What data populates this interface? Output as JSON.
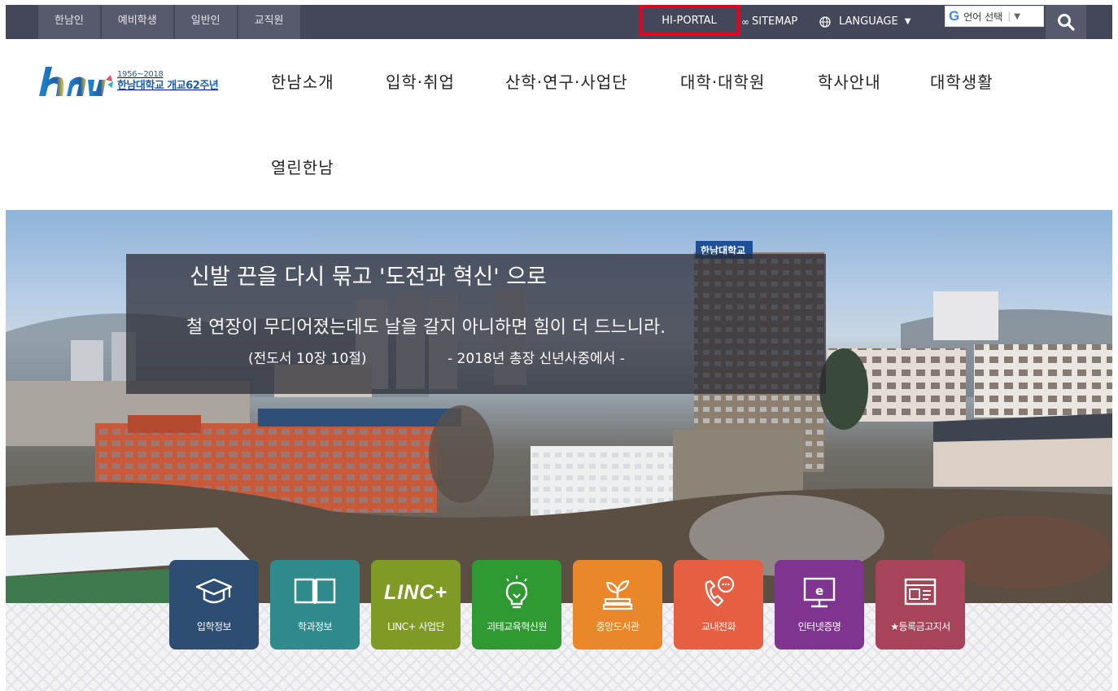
{
  "topbar": {
    "audience": [
      "한남인",
      "예비학생",
      "일반인",
      "교직원"
    ],
    "hiportal": "HI-PORTAL",
    "sitemap": "SITEMAP",
    "language": "LANGUAGE",
    "translate_g": "G",
    "translate_label": "언어 선택",
    "translate_caret": "▼",
    "colors": {
      "bar": "#44475a",
      "tab": "#575a6c",
      "highlight": "#e8001c"
    }
  },
  "logo": {
    "mark": "hnu",
    "years": "1956~2018",
    "name": "한남대학교 개교62주년"
  },
  "nav": {
    "items": [
      "한남소개",
      "입학·취업",
      "산학·연구·사업단",
      "대학·대학원",
      "학사안내",
      "대학생활",
      "열린한남"
    ]
  },
  "hero": {
    "title": "신발 끈을 다시 묶고 '도전과 혁신' 으로",
    "body": "철 연장이 무디어졌는데도 날을 갈지 아니하면 힘이 더 드느니라.",
    "citation": "(전도서 10장 10절)",
    "source": "- 2018년 총장 신년사중에서 -",
    "sign": "한남대학교"
  },
  "quick_links": [
    {
      "label": "입학정보",
      "icon": "graduation-cap-icon",
      "color": "#2d4d72"
    },
    {
      "label": "학과정보",
      "icon": "open-book-icon",
      "color": "#2f8a8c"
    },
    {
      "label": "LINC+ 사업단",
      "icon": "linc-logo",
      "logo_text": "LINC+",
      "color": "#7f9a25"
    },
    {
      "label": "괴테교육혁신원",
      "icon": "lightbulb-icon",
      "color": "#2f9a32"
    },
    {
      "label": "중앙도서관",
      "icon": "sprout-icon",
      "color": "#e9872a"
    },
    {
      "label": "교내전화",
      "icon": "phone-icon",
      "color": "#e75f43"
    },
    {
      "label": "인터넷증명",
      "icon": "monitor-icon",
      "color": "#7f3590"
    },
    {
      "label": "★등록금고지서",
      "icon": "bill-icon",
      "color": "#a8445a"
    }
  ]
}
